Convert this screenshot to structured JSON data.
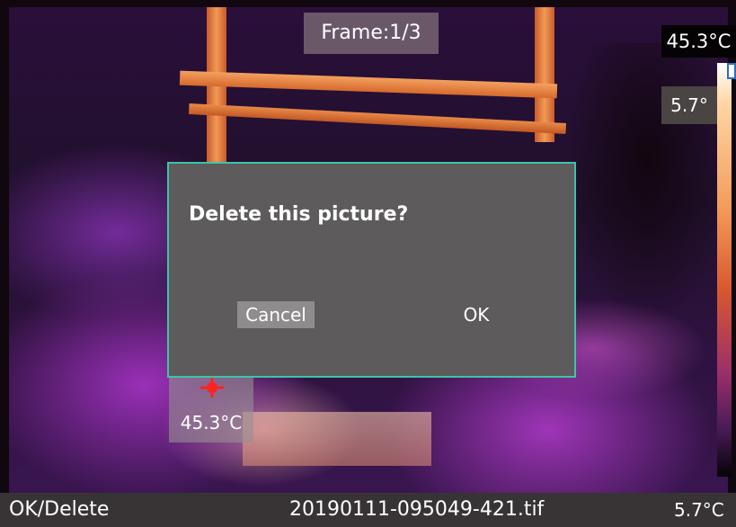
{
  "frame": {
    "label": "Frame:1/3"
  },
  "scale": {
    "max_temp": "45.3°C",
    "min_temp_top": "5.7°",
    "min_temp_bottom": "5.7°C"
  },
  "hotspot": {
    "temp": "45.3°C"
  },
  "dialog": {
    "title": "Delete this picture?",
    "cancel_label": "Cancel",
    "ok_label": "OK"
  },
  "bottom_bar": {
    "hint": "OK/Delete",
    "filename": "20190111-095049-421.tif"
  },
  "colors": {
    "dialog_border": "#3dc4a7",
    "dialog_bg": "#5d5b5c",
    "cancel_bg": "#8e8c8d"
  }
}
